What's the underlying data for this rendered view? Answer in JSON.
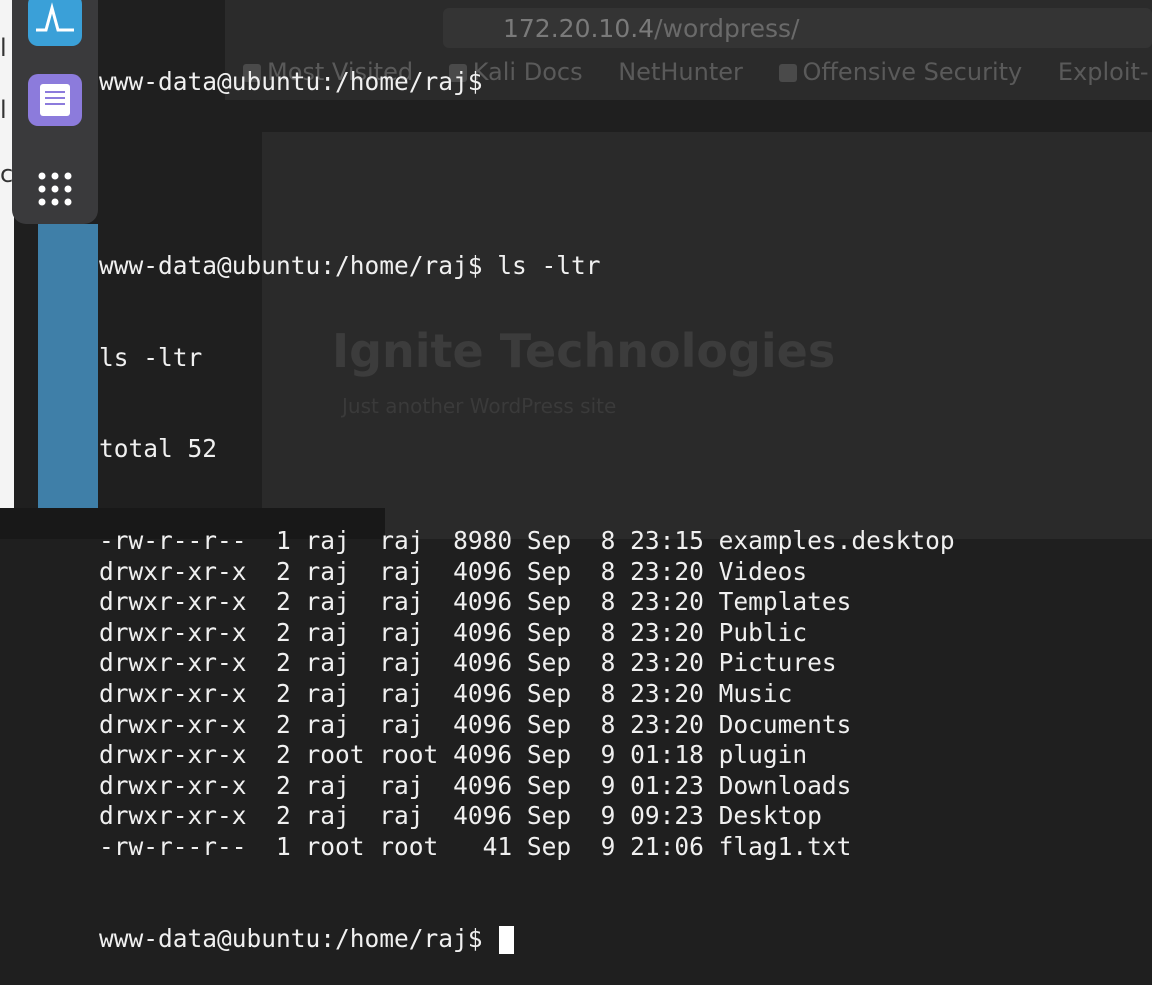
{
  "browser": {
    "url_host": "172.20.10.4",
    "url_path": "/wordpress/",
    "bookmarks": [
      "Most Visited",
      "Kali Docs",
      "NetHunter",
      "Offensive Security",
      "Exploit-"
    ]
  },
  "site": {
    "title": "Ignite Technologies",
    "tagline": "Just another WordPress site"
  },
  "dock": {
    "icons": [
      "system-monitor-icon",
      "text-editor-icon",
      "app-grid-icon"
    ]
  },
  "terminal": {
    "prompt": "www-data@ubuntu:/home/raj$",
    "lines": [
      {
        "text": "www-data@ubuntu:/home/raj$ "
      },
      {
        "text": ""
      },
      {
        "text": "www-data@ubuntu:/home/raj$ ls -ltr"
      },
      {
        "text": "ls -ltr"
      },
      {
        "text": "total 52"
      }
    ],
    "listing": [
      {
        "perm": "-rw-r--r--",
        "links": "1",
        "user": "raj",
        "group": "raj",
        "size": "8980",
        "month": "Sep",
        "day": "8",
        "time": "23:15",
        "name": "examples.desktop"
      },
      {
        "perm": "drwxr-xr-x",
        "links": "2",
        "user": "raj",
        "group": "raj",
        "size": "4096",
        "month": "Sep",
        "day": "8",
        "time": "23:20",
        "name": "Videos"
      },
      {
        "perm": "drwxr-xr-x",
        "links": "2",
        "user": "raj",
        "group": "raj",
        "size": "4096",
        "month": "Sep",
        "day": "8",
        "time": "23:20",
        "name": "Templates"
      },
      {
        "perm": "drwxr-xr-x",
        "links": "2",
        "user": "raj",
        "group": "raj",
        "size": "4096",
        "month": "Sep",
        "day": "8",
        "time": "23:20",
        "name": "Public"
      },
      {
        "perm": "drwxr-xr-x",
        "links": "2",
        "user": "raj",
        "group": "raj",
        "size": "4096",
        "month": "Sep",
        "day": "8",
        "time": "23:20",
        "name": "Pictures"
      },
      {
        "perm": "drwxr-xr-x",
        "links": "2",
        "user": "raj",
        "group": "raj",
        "size": "4096",
        "month": "Sep",
        "day": "8",
        "time": "23:20",
        "name": "Music"
      },
      {
        "perm": "drwxr-xr-x",
        "links": "2",
        "user": "raj",
        "group": "raj",
        "size": "4096",
        "month": "Sep",
        "day": "8",
        "time": "23:20",
        "name": "Documents"
      },
      {
        "perm": "drwxr-xr-x",
        "links": "2",
        "user": "root",
        "group": "root",
        "size": "4096",
        "month": "Sep",
        "day": "9",
        "time": "01:18",
        "name": "plugin"
      },
      {
        "perm": "drwxr-xr-x",
        "links": "2",
        "user": "raj",
        "group": "raj",
        "size": "4096",
        "month": "Sep",
        "day": "9",
        "time": "01:23",
        "name": "Downloads"
      },
      {
        "perm": "drwxr-xr-x",
        "links": "2",
        "user": "raj",
        "group": "raj",
        "size": "4096",
        "month": "Sep",
        "day": "9",
        "time": "09:23",
        "name": "Desktop"
      },
      {
        "perm": "-rw-r--r--",
        "links": "1",
        "user": "root",
        "group": "root",
        "size": "41",
        "month": "Sep",
        "day": "9",
        "time": "21:06",
        "name": "flag1.txt"
      }
    ],
    "final_prompt": "www-data@ubuntu:/home/raj$ "
  },
  "colors": {
    "terminal_bg": "#1f1f1f",
    "terminal_fg": "#f0f0f0",
    "dock_bg": "#3a3a3c"
  }
}
